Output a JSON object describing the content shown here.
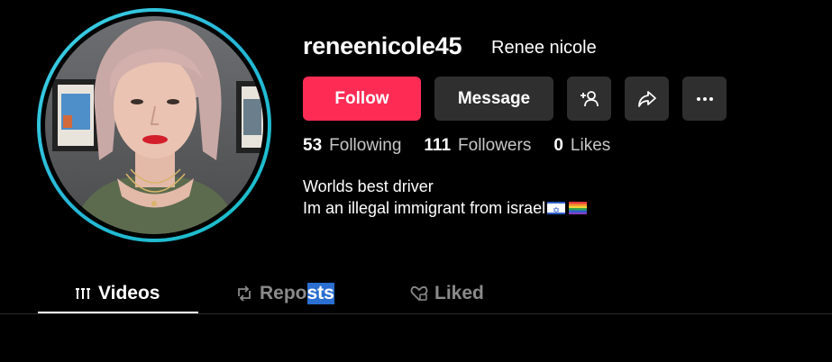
{
  "profile": {
    "username": "reneenicole45",
    "nickname": "Renee nicole",
    "bio_line1": "Worlds best driver",
    "bio_line2": "Im an illegal immigrant from israel",
    "bio_emojis": [
      "israel-flag",
      "rainbow-flag"
    ]
  },
  "actions": {
    "follow_label": "Follow",
    "message_label": "Message",
    "add_friend_icon": "add-user-icon",
    "share_icon": "share-icon",
    "more_icon": "more-icon"
  },
  "stats": [
    {
      "value": "53",
      "label": "Following"
    },
    {
      "value": "111",
      "label": "Followers"
    },
    {
      "value": "0",
      "label": "Likes"
    }
  ],
  "tabs": {
    "videos": "Videos",
    "reposts_part1": "Repo",
    "reposts_part2": "sts",
    "liked": "Liked"
  },
  "colors": {
    "follow_bg": "#fe2c55",
    "button_bg": "#2f2f2f",
    "avatar_ring": "#25b6d6"
  }
}
